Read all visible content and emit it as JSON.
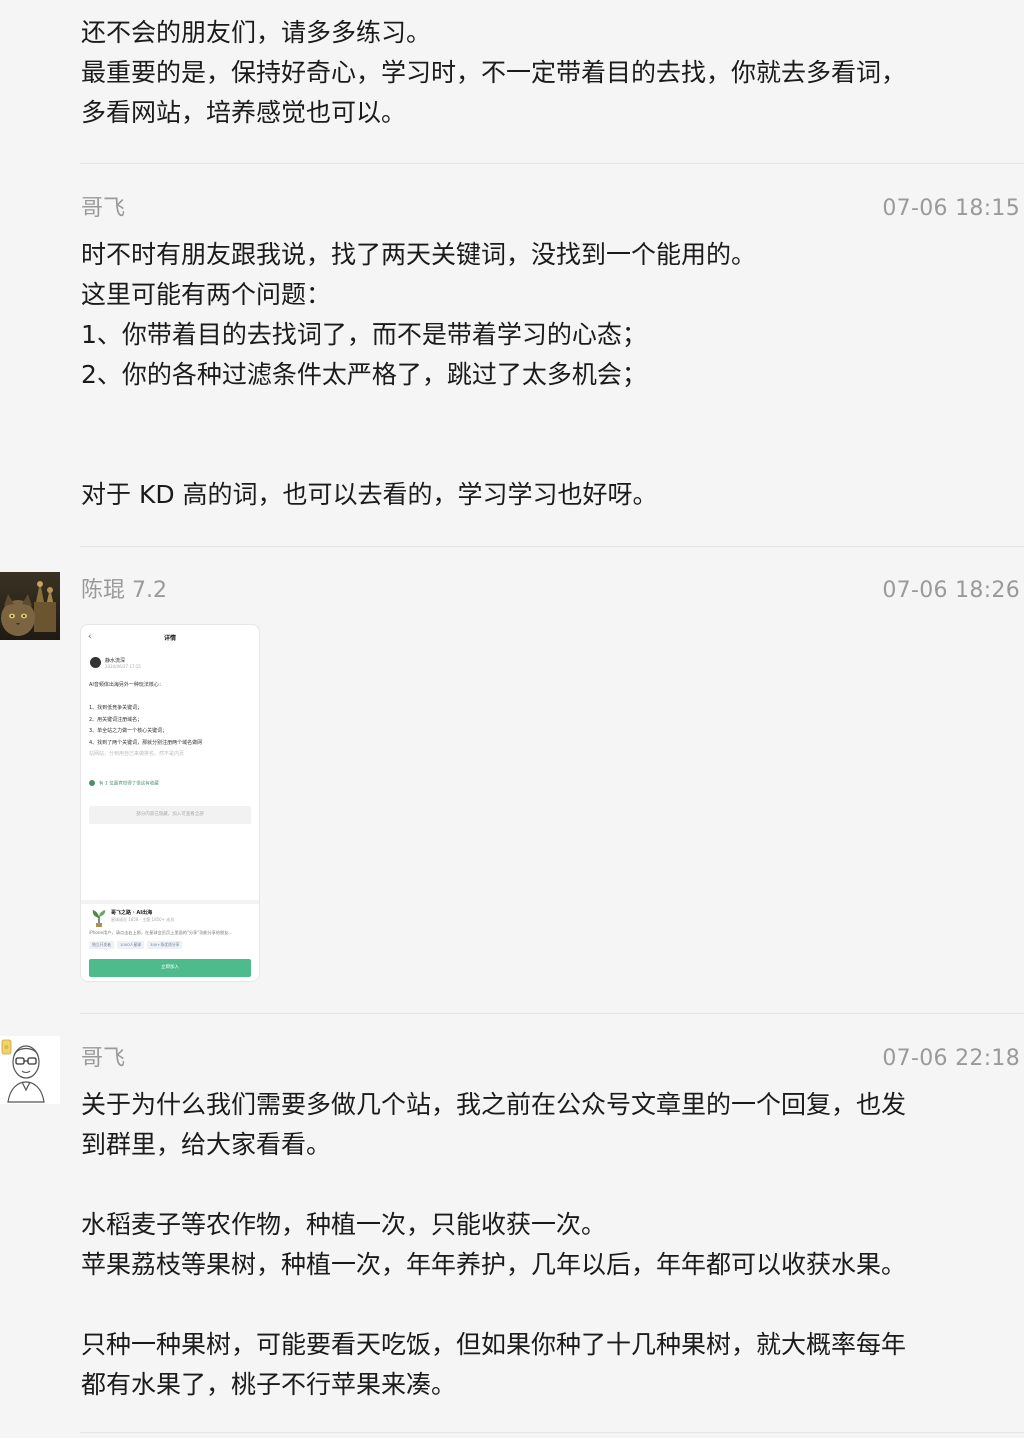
{
  "messages": [
    {
      "lines": [
        "还不会的朋友们，请多多练习。",
        "最重要的是，保持好奇心，学习时，不一定带着目的去找，你就去多看词，",
        "多看网站，培养感觉也可以。"
      ]
    },
    {
      "sender": "哥飞",
      "time": "07-06 18:15",
      "lines": [
        "时不时有朋友跟我说，找了两天关键词，没找到一个能用的。",
        "这里可能有两个问题：",
        "1、你带着目的去找词了，而不是带着学习的心态；",
        "2、你的各种过滤条件太严格了，跳过了太多机会；",
        "",
        "",
        "对于 KD 高的词，也可以去看的，学习学习也好呀。"
      ]
    },
    {
      "sender": "陈琨 7.2",
      "time": "07-06 18:26",
      "avatar_icon": "cat-avatar-icon",
      "attachment": {
        "back_icon": "‹",
        "header": "详情",
        "author": "静水流深",
        "author_sub": "2024/06/27 17:15",
        "body_lines": [
          "AI音频体出海另外一种玩法核心：",
          "",
          "1、找到低竞争关键词；",
          "2、用关键词注册域名；",
          "3、单全站之力做一个核心关键词；",
          "4、找到了两个关键词，那就分别注册两个域名做网",
          "站网站，分到用自己来做排名，然不是内页"
        ],
        "likes": "有 1 位嘉宾觉得了很这有收藏",
        "hidden_note": "部分内容已隐藏，加入可查看全部",
        "group_name": "哥飞之路 · AI出海",
        "group_meta": "星球成员 1858 · 主题 1850+ 成员",
        "group_desc": "iPhone用户，请点击右上角，在星球会员页上里面的\"分享\"功能分享给朋友...",
        "tags": [
          "独立开发者",
          "1000人星球",
          "300+条优质分享"
        ],
        "join_label": "立即加入"
      }
    },
    {
      "sender": "哥飞",
      "time": "07-06 22:18",
      "avatar_icon": "cartoon-face-avatar-icon",
      "lines": [
        "关于为什么我们需要多做几个站，我之前在公众号文章里的一个回复，也发",
        "到群里，给大家看看。",
        "",
        "水稻麦子等农作物，种植一次，只能收获一次。",
        "苹果荔枝等果树，种植一次，年年养护，几年以后，年年都可以收获水果。",
        "",
        "只种一种果树，可能要看天吃饭，但如果你种了十几种果树，就大概率每年",
        "都有水果了，桃子不行苹果来凑。"
      ]
    }
  ],
  "colors": {
    "background": "#f5f5f5",
    "text": "#1b1b1b",
    "meta": "#9a9a9a",
    "divider": "#e4e4e4",
    "join_button": "#4dbb8c"
  }
}
